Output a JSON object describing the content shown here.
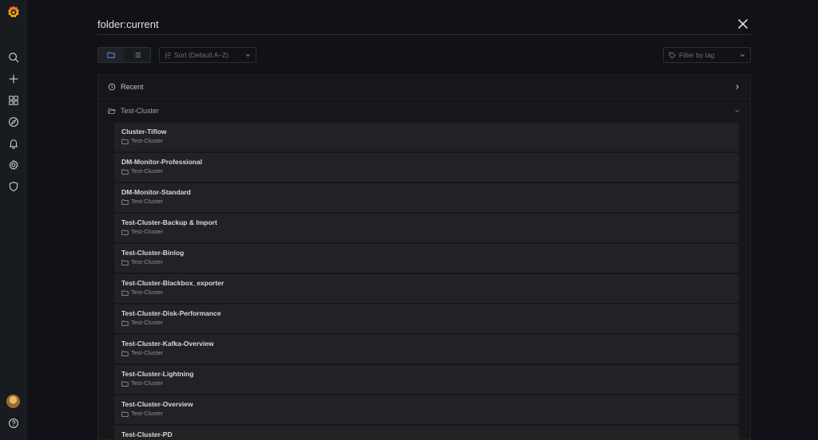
{
  "search": {
    "query": "folder:current"
  },
  "toolbar": {
    "sort_label": "Sort (Default A–Z)",
    "tag_filter_placeholder": "Filter by tag"
  },
  "sections": {
    "recent": {
      "title": "Recent"
    },
    "folder": {
      "title": "Test-Cluster"
    }
  },
  "dashboards": [
    {
      "title": "Cluster-Tiflow",
      "folder": "Test-Cluster"
    },
    {
      "title": "DM-Monitor-Professional",
      "folder": "Test-Cluster"
    },
    {
      "title": "DM-Monitor-Standard",
      "folder": "Test-Cluster"
    },
    {
      "title": "Test-Cluster-Backup & Import",
      "folder": "Test-Cluster"
    },
    {
      "title": "Test-Cluster-Binlog",
      "folder": "Test-Cluster"
    },
    {
      "title": "Test-Cluster-Blackbox_exporter",
      "folder": "Test-Cluster"
    },
    {
      "title": "Test-Cluster-Disk-Performance",
      "folder": "Test-Cluster"
    },
    {
      "title": "Test-Cluster-Kafka-Overview",
      "folder": "Test-Cluster"
    },
    {
      "title": "Test-Cluster-Lightning",
      "folder": "Test-Cluster"
    },
    {
      "title": "Test-Cluster-Overview",
      "folder": "Test-Cluster"
    },
    {
      "title": "Test-Cluster-PD",
      "folder": "Test-Cluster"
    }
  ],
  "sidemenu": {
    "icons": [
      "grafana-logo-icon",
      "search-icon",
      "plus-icon",
      "dashboards-icon",
      "explore-icon",
      "bell-icon",
      "gear-icon",
      "shield-icon",
      "avatar",
      "help-icon"
    ]
  },
  "colors": {
    "background": "#111217",
    "sidemenu": "#181b1f",
    "item": "#202226",
    "accent": "#f46800"
  }
}
